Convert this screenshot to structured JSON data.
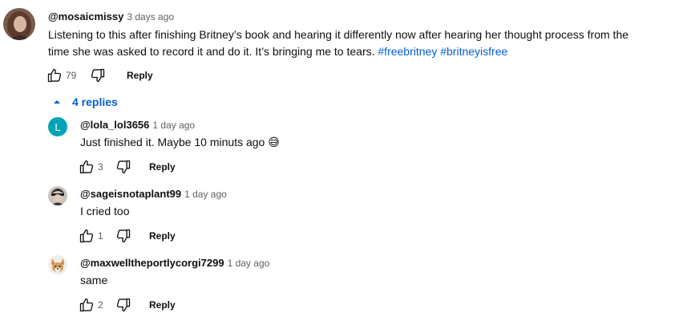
{
  "colors": {
    "link": "#065fd4",
    "secondary": "#606060",
    "text": "#0f0f0f"
  },
  "comment": {
    "author": "@mosaicmissy",
    "time": "3 days ago",
    "text": "Listening to this after finishing Britney’s book and hearing it differently now after hearing her thought process from the time she was asked to record it and do it. It’s bringing me to tears.",
    "hashtags": [
      "#freebritney",
      "#britneyisfree"
    ],
    "likes": "79",
    "reply_label": "Reply",
    "icons": {
      "like": "thumb-up-icon",
      "dislike": "thumb-down-icon"
    }
  },
  "replies_toggle": {
    "label": "4 replies",
    "icon": "caret-up-icon"
  },
  "replies": [
    {
      "avatar_letter": "L",
      "avatar_color": "#00a3b5",
      "author": "@lola_lol3656",
      "time": "1 day ago",
      "text": "Just finished it. Maybe 10 minuts ago",
      "emoji": "😅",
      "likes": "3",
      "reply_label": "Reply"
    },
    {
      "author": "@sageisnotaplant99",
      "time": "1 day ago",
      "text": "I cried too",
      "likes": "1",
      "reply_label": "Reply"
    },
    {
      "author": "@maxwelltheportlycorgi7299",
      "time": "1 day ago",
      "text": "same",
      "likes": "2",
      "reply_label": "Reply"
    }
  ]
}
